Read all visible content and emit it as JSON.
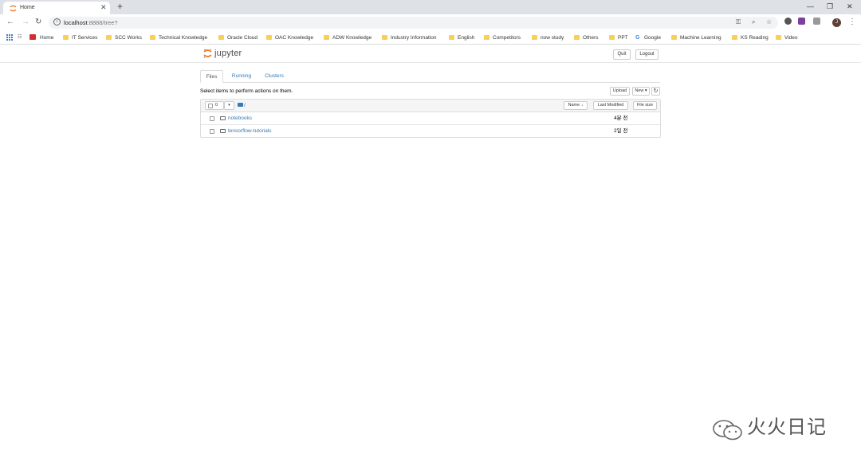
{
  "browser": {
    "tab_title": "Home",
    "tab_close": "✕",
    "new_tab": "+",
    "window": {
      "minimize": "—",
      "restore": "❐",
      "close": "✕"
    },
    "url_host": "localhost",
    "url_rest": ":8888/tree?",
    "bookmarks": [
      {
        "label": "Home",
        "kind": "red"
      },
      {
        "label": "IT Services",
        "kind": "folder"
      },
      {
        "label": "SCC Works",
        "kind": "folder"
      },
      {
        "label": "Technical Knowledge",
        "kind": "folder"
      },
      {
        "label": "Oracle Cloud",
        "kind": "folder"
      },
      {
        "label": "OAC Knowledge",
        "kind": "folder"
      },
      {
        "label": "ADW Knowledge",
        "kind": "folder"
      },
      {
        "label": "Industry Information",
        "kind": "folder"
      },
      {
        "label": "English",
        "kind": "folder"
      },
      {
        "label": "Competitors",
        "kind": "folder"
      },
      {
        "label": "now study",
        "kind": "folder"
      },
      {
        "label": "Others",
        "kind": "folder"
      },
      {
        "label": "PPT",
        "kind": "folder"
      },
      {
        "label": "Google",
        "kind": "google"
      },
      {
        "label": "Machine Learning",
        "kind": "folder"
      },
      {
        "label": "KS Reading",
        "kind": "folder"
      },
      {
        "label": "Video",
        "kind": "folder"
      }
    ],
    "avatar_letter": "J"
  },
  "jupyter": {
    "logo_text": "jupyter",
    "quit_label": "Quit",
    "logout_label": "Logout",
    "tabs": [
      {
        "label": "Files",
        "active": true
      },
      {
        "label": "Running",
        "active": false
      },
      {
        "label": "Clusters",
        "active": false
      }
    ],
    "select_hint": "Select items to perform actions on them.",
    "upload_label": "Upload",
    "new_label": "New ▾",
    "selected_count": "0",
    "breadcrumb": "/",
    "sort_name_label": "Name ↓",
    "sort_modified_label": "Last Modified",
    "sort_size_label": "File size",
    "items": [
      {
        "name": "notebooks",
        "modified": "4분 전"
      },
      {
        "name": "tensorflow-tutorials",
        "modified": "2일 전"
      }
    ]
  },
  "watermark": {
    "text": "火火日记"
  }
}
